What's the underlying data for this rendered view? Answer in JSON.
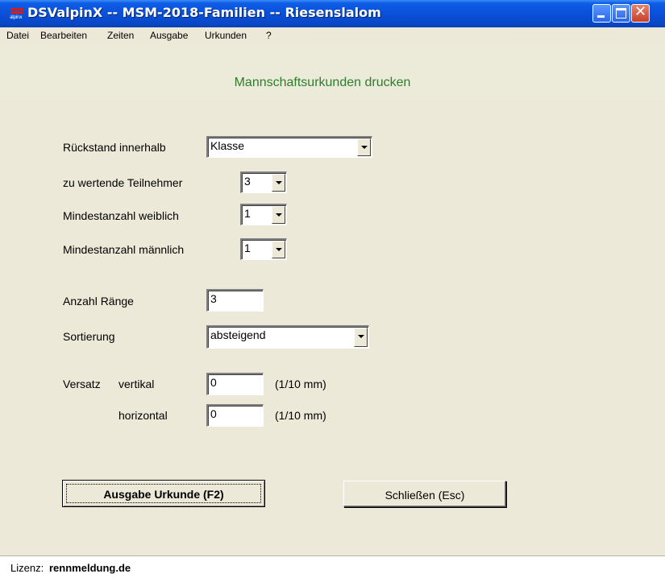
{
  "window": {
    "title": "DSValpinX -- MSM-2018-Familien -- Riesenslalom",
    "icon_text": "alpinx"
  },
  "menu": [
    "Datei",
    "Bearbeiten",
    "Zeiten",
    "Ausgabe",
    "Urkunden",
    "?"
  ],
  "page_title": "Mannschaftsurkunden drucken",
  "form": {
    "rueckstand": {
      "label": "Rückstand innerhalb",
      "value": "Klasse"
    },
    "teilnehmer": {
      "label": "zu wertende Teilnehmer",
      "value": "3"
    },
    "weiblich": {
      "label": "Mindestanzahl weiblich",
      "value": "1"
    },
    "maennlich": {
      "label": "Mindestanzahl männlich",
      "value": "1"
    },
    "raenge": {
      "label": "Anzahl Ränge",
      "value": "3"
    },
    "sortierung": {
      "label": "Sortierung",
      "value": "absteigend"
    },
    "versatz": {
      "label": "Versatz",
      "vertical_label": "vertikal",
      "vertical_value": "0",
      "horizontal_label": "horizontal",
      "horizontal_value": "0",
      "unit": "(1/10 mm)"
    }
  },
  "buttons": {
    "print": "Ausgabe Urkunde (F2)",
    "close": "Schließen (Esc)"
  },
  "status": {
    "label": "Lizenz:",
    "value": "rennmeldung.de"
  },
  "colors": {
    "titlebar": "#0a50d9",
    "page_title": "#2e7d2e",
    "window_bg": "#ece9d8"
  }
}
